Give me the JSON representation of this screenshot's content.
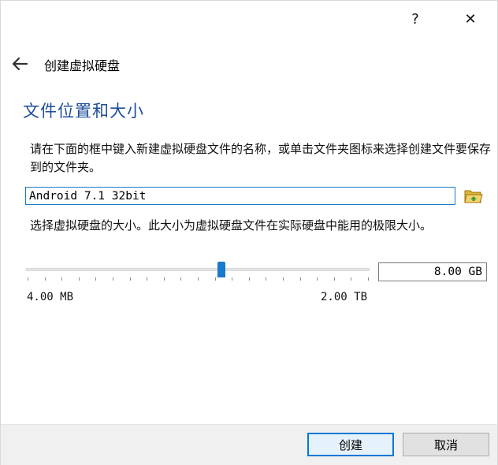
{
  "titlebar": {
    "help_label": "?",
    "close_label": "✕"
  },
  "header": {
    "back_icon": "arrow-left-icon",
    "title": "创建虚拟硬盘"
  },
  "section": {
    "title": "文件位置和大小",
    "description": "请在下面的框中键入新建虚拟硬盘文件的名称，或单击文件夹图标来选择创建文件要保存到的文件夹。"
  },
  "file": {
    "value": "Android 7.1 32bit",
    "folder_icon": "folder-open-icon"
  },
  "size": {
    "description": "选择虚拟硬盘的大小。此大小为虚拟硬盘文件在实际硬盘中能用的极限大小。",
    "value": "8.00 GB",
    "range_min": "4.00 MB",
    "range_max": "2.00 TB",
    "slider_position": 0.57,
    "tick_count": 20
  },
  "footer": {
    "create_label": "创建",
    "cancel_label": "取消"
  },
  "colors": {
    "accent": "#1979ca",
    "section_title": "#1f4e9a",
    "footer_bg": "#f0f0f0"
  }
}
